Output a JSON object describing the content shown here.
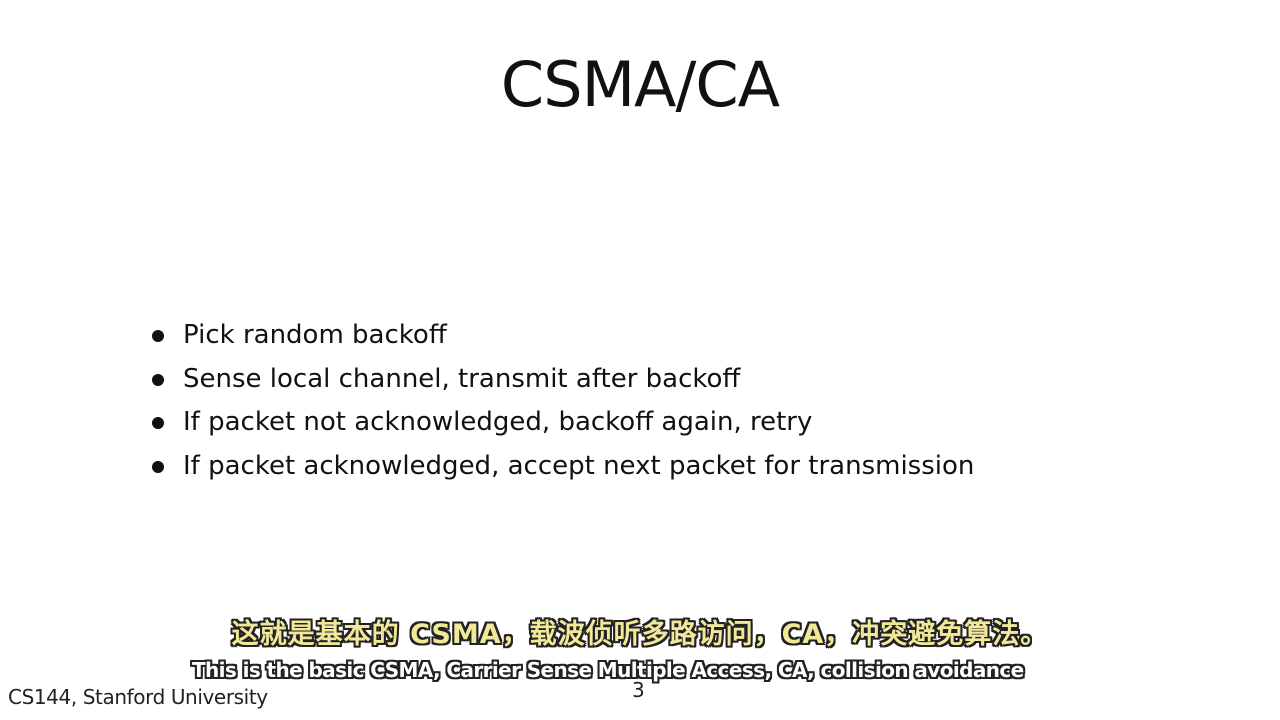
{
  "slide": {
    "title": "CSMA/CA",
    "bullets": [
      "Pick random backoff",
      "Sense local channel, transmit after backoff",
      "If packet not acknowledged, backoff again, retry",
      "If packet acknowledged, accept next packet for transmission"
    ],
    "footer": "CS144, Stanford University",
    "page_number": "3"
  },
  "subtitles": {
    "chinese": "这就是基本的 CSMA，载波侦听多路访问，CA，冲突避免算法。",
    "english": "This is the basic CSMA, Carrier Sense Multiple Access, CA, collision avoidance"
  },
  "colors": {
    "background": "#ffffff",
    "text": "#111111",
    "subtitle_cn": "#f1e89a",
    "subtitle_en": "#ffffff"
  }
}
